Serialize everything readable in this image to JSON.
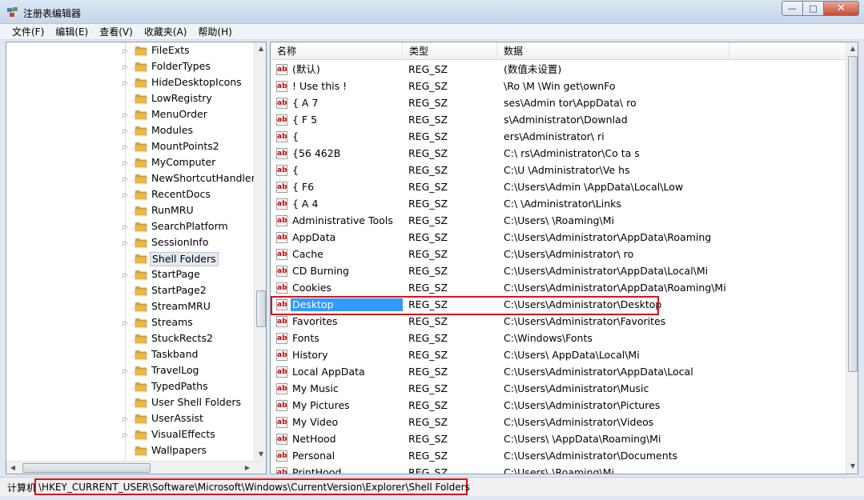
{
  "window": {
    "title": "注册表编辑器",
    "controls": {
      "minimize": "—",
      "maximize": "□",
      "close": "✕"
    }
  },
  "menu": [
    {
      "label": "文件(F)"
    },
    {
      "label": "编辑(E)"
    },
    {
      "label": "查看(V)"
    },
    {
      "label": "收藏夹(A)"
    },
    {
      "label": "帮助(H)"
    }
  ],
  "tree": {
    "items": [
      {
        "label": "FileExts"
      },
      {
        "label": "FolderTypes"
      },
      {
        "label": "HideDesktopIcons"
      },
      {
        "label": "LowRegistry"
      },
      {
        "label": "MenuOrder"
      },
      {
        "label": "Modules"
      },
      {
        "label": "MountPoints2"
      },
      {
        "label": "MyComputer"
      },
      {
        "label": "NewShortcutHandlers"
      },
      {
        "label": "RecentDocs"
      },
      {
        "label": "RunMRU"
      },
      {
        "label": "SearchPlatform"
      },
      {
        "label": "SessionInfo"
      },
      {
        "label": "Shell Folders"
      },
      {
        "label": "StartPage"
      },
      {
        "label": "StartPage2"
      },
      {
        "label": "StreamMRU"
      },
      {
        "label": "Streams"
      },
      {
        "label": "StuckRects2"
      },
      {
        "label": "Taskband"
      },
      {
        "label": "TravelLog"
      },
      {
        "label": "TypedPaths"
      },
      {
        "label": "User Shell Folders"
      },
      {
        "label": "UserAssist"
      },
      {
        "label": "VisualEffects"
      },
      {
        "label": "Wallpapers"
      }
    ],
    "expanders": [
      "▷",
      "▷",
      "▷",
      "",
      "▷",
      "▷",
      "▷",
      "▷",
      "▷",
      "▷",
      "",
      "▷",
      "▷",
      "",
      "▷",
      "",
      "",
      "▷",
      "",
      "",
      "▷",
      "",
      "",
      "▷",
      "▷",
      ""
    ],
    "selected_index": 13
  },
  "list": {
    "columns": {
      "name": "名称",
      "type": "类型",
      "data": "数据"
    },
    "icon_text": "ab",
    "rows": [
      {
        "name": "(默认)",
        "type": "REG_SZ",
        "data": "(数值未设置)"
      },
      {
        "name": "!  Use this  !",
        "type": "REG_SZ",
        "data": "\\Ro   \\M      \\Win   get\\ownFo"
      },
      {
        "name": "{  A   7",
        "type": "REG_SZ",
        "data": "   ses\\Admin  tor\\AppData\\  ro  "
      },
      {
        "name": "{  F    5",
        "type": "REG_SZ",
        "data": "    s\\Administrator\\Downlad"
      },
      {
        "name": "{",
        "type": "REG_SZ",
        "data": "   ers\\Administrator\\  ri  "
      },
      {
        "name": "{56   462B",
        "type": "REG_SZ",
        "data": "C:\\  rs\\Administrator\\Co ta s"
      },
      {
        "name": "{",
        "type": "REG_SZ",
        "data": "C:\\U   \\Administrator\\Ve  hs"
      },
      {
        "name": "{   F6",
        "type": "REG_SZ",
        "data": "C:\\Users\\Admin  \\AppData\\Local\\Low"
      },
      {
        "name": "{  A  4",
        "type": "REG_SZ",
        "data": "C:\\  \\Administrator\\Links"
      },
      {
        "name": "Administrative Tools",
        "type": "REG_SZ",
        "data": "C:\\Users\\       \\Roaming\\Mi"
      },
      {
        "name": "AppData",
        "type": "REG_SZ",
        "data": "C:\\Users\\Administrator\\AppData\\Roaming"
      },
      {
        "name": "Cache",
        "type": "REG_SZ",
        "data": "C:\\Users\\Administrator\\     ro"
      },
      {
        "name": "CD Burning",
        "type": "REG_SZ",
        "data": "C:\\Users\\Administrator\\AppData\\Local\\Mi"
      },
      {
        "name": "Cookies",
        "type": "REG_SZ",
        "data": "C:\\Users\\Administrator\\AppData\\Roaming\\Mi"
      },
      {
        "name": "Desktop",
        "type": "REG_SZ",
        "data": "C:\\Users\\Administrator\\Desktop"
      },
      {
        "name": "Favorites",
        "type": "REG_SZ",
        "data": "C:\\Users\\Administrator\\Favorites"
      },
      {
        "name": "Fonts",
        "type": "REG_SZ",
        "data": "C:\\Windows\\Fonts"
      },
      {
        "name": "History",
        "type": "REG_SZ",
        "data": "C:\\Users\\       AppData\\Local\\Mi"
      },
      {
        "name": "Local AppData",
        "type": "REG_SZ",
        "data": "C:\\Users\\Administrator\\AppData\\Local"
      },
      {
        "name": "My Music",
        "type": "REG_SZ",
        "data": "C:\\Users\\Administrator\\Music"
      },
      {
        "name": "My Pictures",
        "type": "REG_SZ",
        "data": "C:\\Users\\Administrator\\Pictures"
      },
      {
        "name": "My Video",
        "type": "REG_SZ",
        "data": "C:\\Users\\Administrator\\Videos"
      },
      {
        "name": "NetHood",
        "type": "REG_SZ",
        "data": "C:\\Users\\      \\AppData\\Roaming\\Mi"
      },
      {
        "name": "Personal",
        "type": "REG_SZ",
        "data": "C:\\Users\\Administrator\\Documents"
      },
      {
        "name": "PrintHood",
        "type": "REG_SZ",
        "data": "C:\\Users\\       \\Roaming\\Mi"
      }
    ],
    "selected_index": 14
  },
  "statusbar": {
    "prefix": "计算机",
    "path": "\\HKEY_CURRENT_USER\\Software\\Microsoft\\Windows\\CurrentVersion\\Explorer\\Shell Folders"
  },
  "colors": {
    "highlight_border": "#d9141b",
    "selection": "#3399ff",
    "folder": "#e8b84a"
  }
}
